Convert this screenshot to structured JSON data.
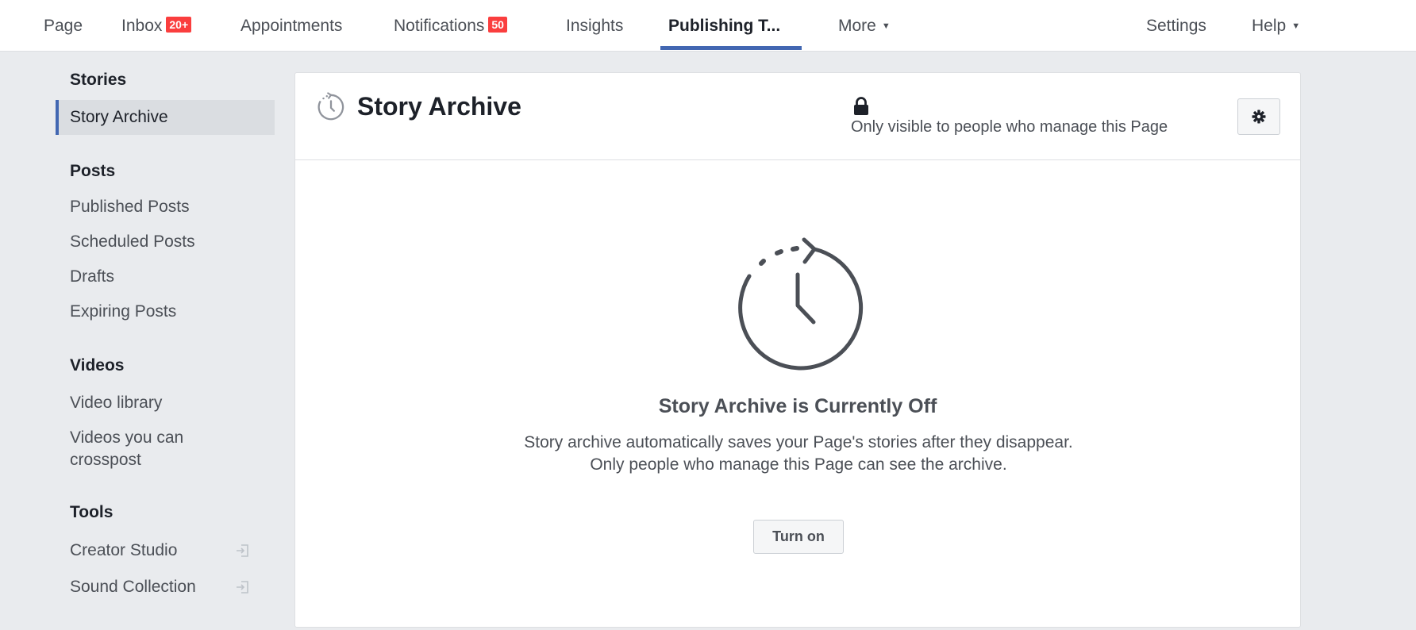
{
  "topnav": {
    "page": "Page",
    "inbox": "Inbox",
    "inbox_badge": "20+",
    "appointments": "Appointments",
    "notifications": "Notifications",
    "notifications_badge": "50",
    "insights": "Insights",
    "publishing_tools": "Publishing T...",
    "more": "More",
    "settings": "Settings",
    "help": "Help"
  },
  "sidebar": {
    "stories_heading": "Stories",
    "story_archive": "Story Archive",
    "posts_heading": "Posts",
    "published_posts": "Published Posts",
    "scheduled_posts": "Scheduled Posts",
    "drafts": "Drafts",
    "expiring_posts": "Expiring Posts",
    "videos_heading": "Videos",
    "video_library": "Video library",
    "videos_crosspost_line1": "Videos you can",
    "videos_crosspost_line2": "crosspost",
    "tools_heading": "Tools",
    "creator_studio": "Creator Studio",
    "sound_collection": "Sound Collection"
  },
  "main": {
    "title": "Story Archive",
    "visibility_note": "Only visible to people who manage this Page",
    "empty_title": "Story Archive is Currently Off",
    "empty_desc": "Story archive automatically saves your Page's stories after they disappear. Only people who manage this Page can see the archive.",
    "turn_on_label": "Turn on"
  },
  "colors": {
    "accent": "#4267b2",
    "badge": "#fa3e3e",
    "background": "#e9ebee"
  },
  "icons": {
    "title": "story-archive-icon",
    "lock": "lock-icon",
    "gear": "gear-icon",
    "external": "external-link-icon"
  }
}
